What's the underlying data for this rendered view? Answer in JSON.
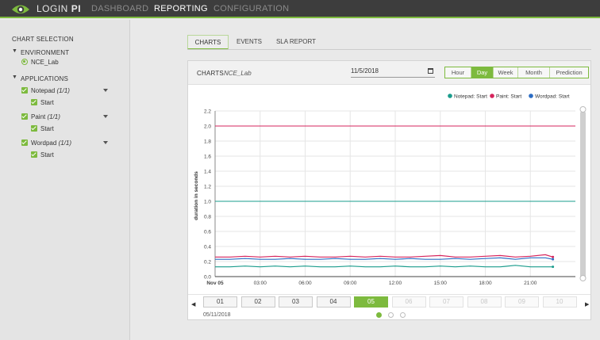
{
  "brand": {
    "name_light": "LOGIN",
    "name_bold": "PI",
    "accent": "#7dba3e",
    "logo_icon": "eye-icon"
  },
  "nav": [
    {
      "label": "DASHBOARD",
      "active": false
    },
    {
      "label": "REPORTING",
      "active": true
    },
    {
      "label": "CONFIGURATION",
      "active": false
    }
  ],
  "sidebar": {
    "title": "CHART SELECTION",
    "environment": {
      "label": "ENVIRONMENT",
      "selected": "NCE_Lab"
    },
    "applications": {
      "label": "APPLICATIONS",
      "items": [
        {
          "name": "Notepad",
          "count": "(1/1)",
          "child": "Start"
        },
        {
          "name": "Paint",
          "count": "(1/1)",
          "child": "Start"
        },
        {
          "name": "Wordpad",
          "count": "(1/1)",
          "child": "Start"
        }
      ]
    }
  },
  "tabs": [
    {
      "label": "CHARTS",
      "active": true
    },
    {
      "label": "EVENTS",
      "active": false
    },
    {
      "label": "SLA REPORT",
      "active": false
    }
  ],
  "panel": {
    "title": "CHARTS",
    "environment": "NCE_Lab",
    "date_value": "11/5/2018",
    "date_icon": "calendar-icon",
    "ranges": [
      {
        "label": "Hour",
        "active": false
      },
      {
        "label": "Day",
        "active": true
      },
      {
        "label": "Week",
        "active": false
      },
      {
        "label": "Month",
        "active": false
      },
      {
        "label": "Prediction",
        "active": false
      }
    ]
  },
  "chart_data": {
    "type": "line",
    "xlabel": "",
    "ylabel": "duration in seconds",
    "ylim": [
      0,
      2.2
    ],
    "yticks": [
      "0.0",
      "0.2",
      "0.4",
      "0.6",
      "0.8",
      "1.0",
      "1.2",
      "1.4",
      "1.6",
      "1.8",
      "2.0",
      "2.2"
    ],
    "xlim": [
      0,
      24
    ],
    "xticks": [
      "Nov 05",
      "03:00",
      "06:00",
      "09:00",
      "12:00",
      "15:00",
      "18:00",
      "21:00"
    ],
    "grid": true,
    "legend_position": "top-right",
    "x": [
      0,
      1,
      2,
      3,
      4,
      5,
      6,
      7,
      8,
      9,
      10,
      11,
      12,
      13,
      14,
      15,
      16,
      17,
      18,
      19,
      20,
      21,
      22,
      22.5
    ],
    "series": [
      {
        "name": "Notepad: Start",
        "color": "#1a9c8c",
        "values": [
          0.13,
          0.13,
          0.14,
          0.13,
          0.14,
          0.13,
          0.14,
          0.13,
          0.13,
          0.14,
          0.13,
          0.13,
          0.14,
          0.13,
          0.13,
          0.14,
          0.13,
          0.14,
          0.13,
          0.13,
          0.15,
          0.13,
          0.13,
          0.13
        ]
      },
      {
        "name": "Paint: Start",
        "color": "#d6245c",
        "values": [
          0.26,
          0.26,
          0.27,
          0.26,
          0.27,
          0.26,
          0.27,
          0.26,
          0.26,
          0.27,
          0.26,
          0.27,
          0.26,
          0.26,
          0.27,
          0.28,
          0.26,
          0.26,
          0.27,
          0.28,
          0.26,
          0.27,
          0.29,
          0.26
        ]
      },
      {
        "name": "Wordpad: Start",
        "color": "#2b6cc4",
        "values": [
          0.23,
          0.23,
          0.24,
          0.23,
          0.23,
          0.24,
          0.23,
          0.23,
          0.24,
          0.23,
          0.23,
          0.24,
          0.23,
          0.24,
          0.23,
          0.23,
          0.24,
          0.23,
          0.24,
          0.25,
          0.23,
          0.25,
          0.25,
          0.23
        ]
      }
    ],
    "reference_lines": [
      {
        "value": 2.0,
        "color": "#d6245c"
      },
      {
        "value": 1.0,
        "color": "#1a9c8c"
      }
    ]
  },
  "pager": {
    "pages": [
      {
        "label": "01",
        "state": "normal"
      },
      {
        "label": "02",
        "state": "normal"
      },
      {
        "label": "03",
        "state": "normal"
      },
      {
        "label": "04",
        "state": "normal"
      },
      {
        "label": "05",
        "state": "active"
      },
      {
        "label": "06",
        "state": "disabled"
      },
      {
        "label": "07",
        "state": "disabled"
      },
      {
        "label": "08",
        "state": "disabled"
      },
      {
        "label": "09",
        "state": "disabled"
      },
      {
        "label": "10",
        "state": "disabled"
      }
    ],
    "date": "05/11/2018",
    "prev_icon": "triangle-left-icon",
    "next_icon": "triangle-right-icon",
    "dots": [
      true,
      false,
      false
    ]
  }
}
